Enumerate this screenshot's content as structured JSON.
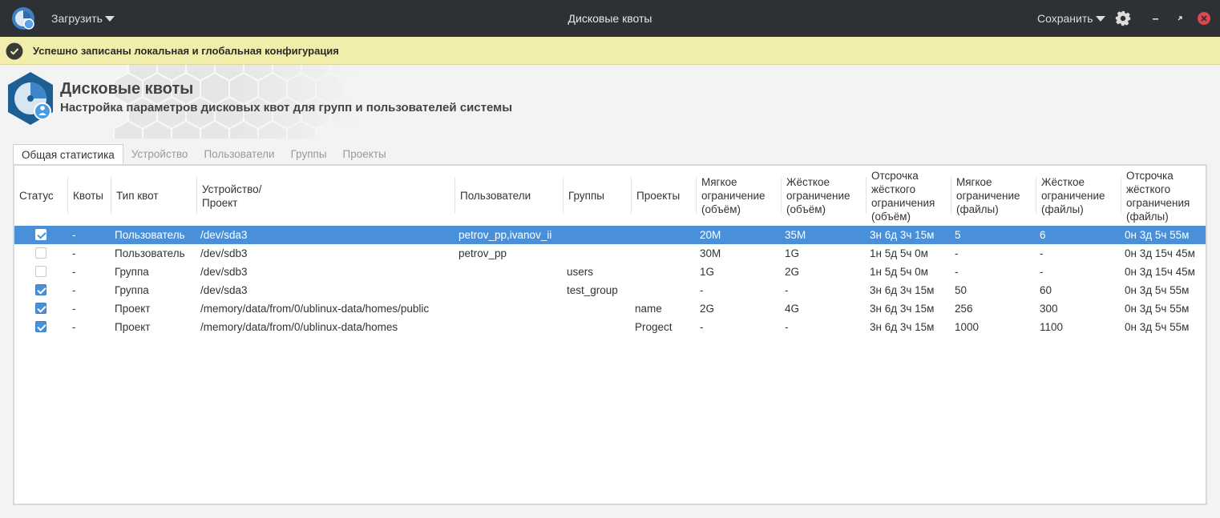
{
  "titlebar": {
    "load_label": "Загрузить",
    "title": "Дисковые квоты",
    "save_label": "Сохранить"
  },
  "infobar": {
    "message": "Успешно записаны локальная и глобальная конфигурация"
  },
  "header": {
    "title": "Дисковые квоты",
    "subtitle": "Настройка параметров дисковых квот для групп и пользователей системы"
  },
  "tabs": [
    {
      "label": "Общая статистика",
      "active": true
    },
    {
      "label": "Устройство"
    },
    {
      "label": "Пользователи"
    },
    {
      "label": "Группы"
    },
    {
      "label": "Проекты"
    }
  ],
  "table": {
    "columns": [
      "Статус",
      "Квоты",
      "Тип квот",
      "Устройство/\nПроект",
      "Пользователи",
      "Группы",
      "Проекты",
      "Мягкое\nограничение\n(объём)",
      "Жёсткое\nограничение\n(объём)",
      "Отсрочка\nжёсткого\nограничения\n(объём)",
      "Мягкое\nограничение\n(файлы)",
      "Жёсткое\nограничение\n(файлы)",
      "Отсрочка\nжёсткого\nограничения\n(файлы)"
    ],
    "rows": [
      {
        "status": true,
        "cells": [
          "-",
          "Пользователь",
          "/dev/sda3",
          "petrov_pp,ivanov_ii",
          "",
          "",
          "20M",
          "35M",
          "3н 6д 3ч 15м",
          "5",
          "6",
          "0н 3д 5ч 55м"
        ],
        "selected": true
      },
      {
        "status": false,
        "cells": [
          "-",
          "Пользователь",
          "/dev/sdb3",
          "petrov_pp",
          "",
          "",
          "30M",
          "1G",
          "1н 5д 5ч 0м",
          "-",
          "-",
          "0н 3д 15ч 45м"
        ]
      },
      {
        "status": false,
        "cells": [
          "-",
          "Группа",
          "/dev/sdb3",
          "",
          "users",
          "",
          "1G",
          "2G",
          "1н 5д 5ч 0м",
          "-",
          "-",
          "0н 3д 15ч 45м"
        ]
      },
      {
        "status": true,
        "cells": [
          "-",
          "Группа",
          "/dev/sda3",
          "",
          "test_group",
          "",
          "-",
          "-",
          "3н 6д 3ч 15м",
          "50",
          "60",
          "0н 3д 5ч 55м"
        ]
      },
      {
        "status": true,
        "cells": [
          "-",
          "Проект",
          "/memory/data/from/0/ublinux-data/homes/public",
          "",
          "",
          "name",
          "2G",
          "4G",
          "3н 6д 3ч 15м",
          "256",
          "300",
          "0н 3д 5ч 55м"
        ]
      },
      {
        "status": true,
        "cells": [
          "-",
          "Проект",
          "/memory/data/from/0/ublinux-data/homes",
          "",
          "",
          "Progect",
          "-",
          "-",
          "3н 6д 3ч 15м",
          "1000",
          "1100",
          "0н 3д 5ч 55м"
        ]
      }
    ]
  },
  "colors": {
    "titlebar_bg": "#2d3136",
    "infobar_bg": "#f1eeac",
    "selection": "#4a90d9",
    "close_button": "#e0464e"
  },
  "icons": {
    "app": "disk-quota-app-icon",
    "info": "check-circle-icon",
    "settings": "gear-icon",
    "minimize": "minimize-icon",
    "maximize": "maximize-icon",
    "close": "close-icon"
  }
}
